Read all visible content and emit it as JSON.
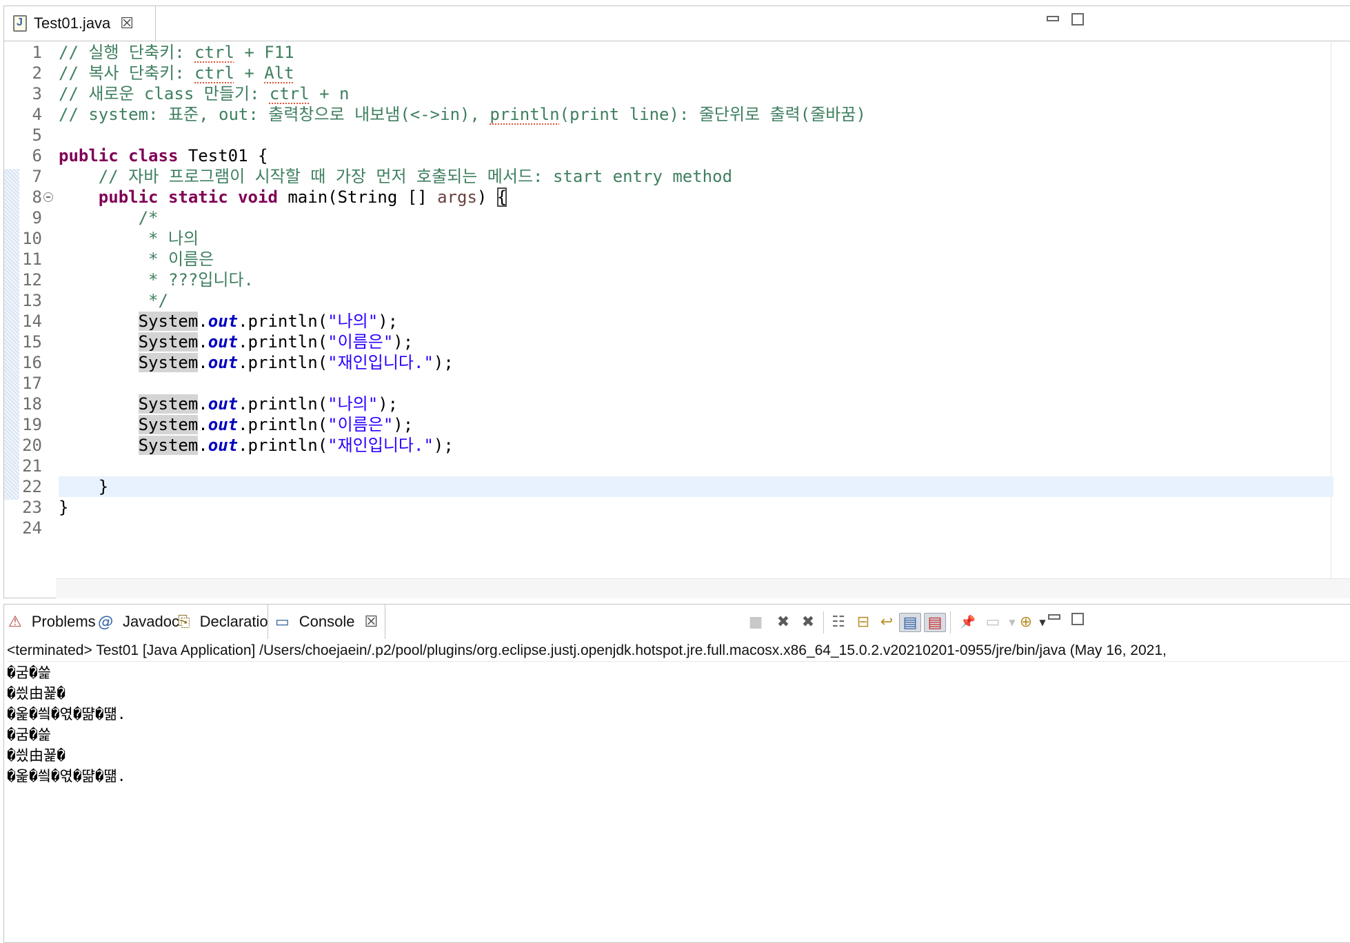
{
  "editor": {
    "tab_label": "Test01.java",
    "tab_icon": "java-file-icon",
    "lines": [
      {
        "n": "1",
        "segs": [
          {
            "t": "// 실행 단축키: ",
            "c": "t-comment"
          },
          {
            "t": "ctrl",
            "c": "t-comment t-squiggle"
          },
          {
            "t": " + F11",
            "c": "t-comment"
          }
        ]
      },
      {
        "n": "2",
        "segs": [
          {
            "t": "// 복사 단축키: ",
            "c": "t-comment"
          },
          {
            "t": "ctrl",
            "c": "t-comment t-squiggle"
          },
          {
            "t": " + ",
            "c": "t-comment"
          },
          {
            "t": "Alt",
            "c": "t-comment t-squiggle"
          }
        ]
      },
      {
        "n": "3",
        "segs": [
          {
            "t": "// 새로운 class 만들기: ",
            "c": "t-comment"
          },
          {
            "t": "ctrl",
            "c": "t-comment t-squiggle"
          },
          {
            "t": " + n",
            "c": "t-comment"
          }
        ]
      },
      {
        "n": "4",
        "segs": [
          {
            "t": "// system: 표준, out: 출력창으로 내보냄(<->in), ",
            "c": "t-comment"
          },
          {
            "t": "println",
            "c": "t-comment t-squiggle"
          },
          {
            "t": "(print line): 줄단위로 출력(줄바꿈)",
            "c": "t-comment"
          }
        ]
      },
      {
        "n": "5",
        "segs": []
      },
      {
        "n": "6",
        "segs": [
          {
            "t": "public",
            "c": "t-kw"
          },
          {
            "t": " "
          },
          {
            "t": "class",
            "c": "t-kw"
          },
          {
            "t": " Test01 {"
          }
        ]
      },
      {
        "n": "7",
        "segs": [
          {
            "t": "    "
          },
          {
            "t": "// 자바 프로그램이 시작할 때 가장 먼저 호출되는 메서드: start entry method",
            "c": "t-comment"
          }
        ]
      },
      {
        "n": "8",
        "fold": true,
        "segs": [
          {
            "t": "    "
          },
          {
            "t": "public",
            "c": "t-kw"
          },
          {
            "t": " "
          },
          {
            "t": "static",
            "c": "t-kw"
          },
          {
            "t": " "
          },
          {
            "t": "void",
            "c": "t-kw"
          },
          {
            "t": " main(String [] "
          },
          {
            "t": "args",
            "c": "t-param"
          },
          {
            "t": ") "
          },
          {
            "t": "{",
            "c": "t-bracket"
          }
        ]
      },
      {
        "n": "9",
        "segs": [
          {
            "t": "        "
          },
          {
            "t": "/*",
            "c": "t-comment"
          }
        ]
      },
      {
        "n": "10",
        "segs": [
          {
            "t": "         "
          },
          {
            "t": "* 나의",
            "c": "t-comment"
          }
        ]
      },
      {
        "n": "11",
        "segs": [
          {
            "t": "         "
          },
          {
            "t": "* 이름은",
            "c": "t-comment"
          }
        ]
      },
      {
        "n": "12",
        "segs": [
          {
            "t": "         "
          },
          {
            "t": "* ???입니다.",
            "c": "t-comment"
          }
        ]
      },
      {
        "n": "13",
        "segs": [
          {
            "t": "         "
          },
          {
            "t": "*/",
            "c": "t-comment"
          }
        ]
      },
      {
        "n": "14",
        "segs": [
          {
            "t": "        "
          },
          {
            "t": "System",
            "c": "t-hl"
          },
          {
            "t": "."
          },
          {
            "t": "out",
            "c": "t-field"
          },
          {
            "t": ".println("
          },
          {
            "t": "\"나의\"",
            "c": "t-str"
          },
          {
            "t": ");"
          }
        ]
      },
      {
        "n": "15",
        "segs": [
          {
            "t": "        "
          },
          {
            "t": "System",
            "c": "t-hl"
          },
          {
            "t": "."
          },
          {
            "t": "out",
            "c": "t-field"
          },
          {
            "t": ".println("
          },
          {
            "t": "\"이름은\"",
            "c": "t-str"
          },
          {
            "t": ");"
          }
        ]
      },
      {
        "n": "16",
        "segs": [
          {
            "t": "        "
          },
          {
            "t": "System",
            "c": "t-hl"
          },
          {
            "t": "."
          },
          {
            "t": "out",
            "c": "t-field"
          },
          {
            "t": ".println("
          },
          {
            "t": "\"재인입니다.\"",
            "c": "t-str"
          },
          {
            "t": ");"
          }
        ]
      },
      {
        "n": "17",
        "segs": []
      },
      {
        "n": "18",
        "segs": [
          {
            "t": "        "
          },
          {
            "t": "System",
            "c": "t-hl"
          },
          {
            "t": "."
          },
          {
            "t": "out",
            "c": "t-field"
          },
          {
            "t": ".println("
          },
          {
            "t": "\"나의\"",
            "c": "t-str"
          },
          {
            "t": ");"
          }
        ]
      },
      {
        "n": "19",
        "segs": [
          {
            "t": "        "
          },
          {
            "t": "System",
            "c": "t-hl"
          },
          {
            "t": "."
          },
          {
            "t": "out",
            "c": "t-field"
          },
          {
            "t": ".println("
          },
          {
            "t": "\"이름은\"",
            "c": "t-str"
          },
          {
            "t": ");"
          }
        ]
      },
      {
        "n": "20",
        "segs": [
          {
            "t": "        "
          },
          {
            "t": "System",
            "c": "t-hl"
          },
          {
            "t": "."
          },
          {
            "t": "out",
            "c": "t-field"
          },
          {
            "t": ".println("
          },
          {
            "t": "\"재인입니다.\"",
            "c": "t-str"
          },
          {
            "t": ");"
          }
        ]
      },
      {
        "n": "21",
        "segs": []
      },
      {
        "n": "22",
        "current": true,
        "segs": [
          {
            "t": "    }"
          }
        ]
      },
      {
        "n": "23",
        "segs": [
          {
            "t": "}"
          }
        ]
      },
      {
        "n": "24",
        "segs": []
      }
    ]
  },
  "panel": {
    "tabs": [
      {
        "label": "Problems",
        "icon": "problems-icon",
        "glyph": "⚠"
      },
      {
        "label": "Javadoc",
        "icon": "javadoc-icon",
        "glyph": "@"
      },
      {
        "label": "Declaration",
        "icon": "declaration-icon",
        "glyph": "⎘"
      },
      {
        "label": "Console",
        "icon": "console-icon",
        "glyph": "▭"
      }
    ],
    "toolbar": [
      {
        "name": "terminate-icon",
        "glyph": "■"
      },
      {
        "name": "remove-launch-icon",
        "glyph": "✖"
      },
      {
        "name": "remove-all-terminated-icon",
        "glyph": "✖"
      },
      {
        "name": "clear-console-icon",
        "glyph": "☷"
      },
      {
        "name": "scroll-lock-icon",
        "glyph": "⊟"
      },
      {
        "name": "word-wrap-icon",
        "glyph": "↩"
      },
      {
        "name": "show-on-stdout-icon",
        "glyph": "▤"
      },
      {
        "name": "show-on-stderr-icon",
        "glyph": "▤"
      },
      {
        "name": "pin-console-icon",
        "glyph": "📌"
      },
      {
        "name": "display-console-icon",
        "glyph": "▭"
      },
      {
        "name": "open-console-icon",
        "glyph": "⊕"
      }
    ],
    "console_status": "<terminated> Test01 [Java Application] /Users/choejaein/.p2/pool/plugins/org.eclipse.justj.openjdk.hotspot.jre.full.macosx.x86_64_15.0.2.v20210201-0955/jre/bin/java  (May 16, 2021,",
    "output": [
      "�굼�쓽",
      "�씠由꾩�",
      "�옱�씤�엯�땲�떎.",
      "�굼�쓽",
      "�씠由꾩�",
      "�옱�씤�엯�땲�떎."
    ]
  },
  "colors": {
    "comment": "#3f7f5f",
    "keyword": "#7f0055",
    "string": "#2a00ff",
    "field": "#0000c0",
    "current_line": "#e8f2fe"
  }
}
